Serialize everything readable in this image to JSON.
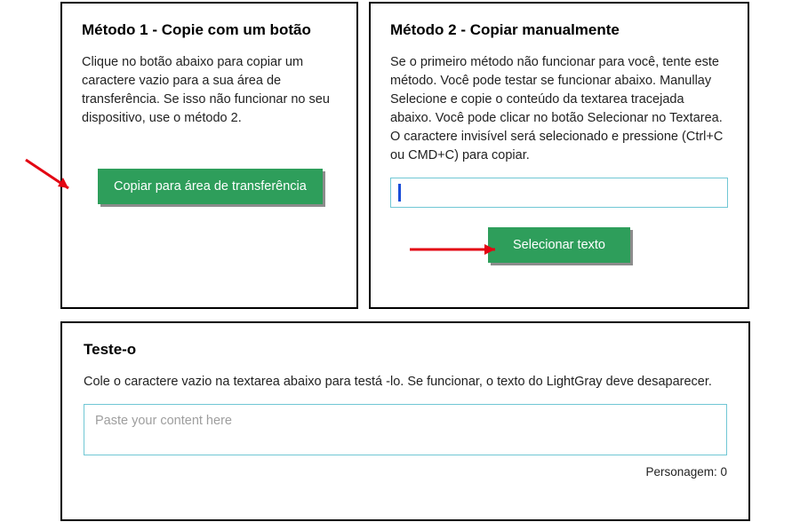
{
  "method1": {
    "title": "Método 1 - Copie com um botão",
    "description": "Clique no botão abaixo para copiar um caractere vazio para a sua área de transferência. Se isso não funcionar no seu dispositivo, use o método 2.",
    "button_label": "Copiar para área de transferência"
  },
  "method2": {
    "title": "Método 2 - Copiar manualmente",
    "description": "Se o primeiro método não funcionar para você, tente este método. Você pode testar se funcionar abaixo. Manullay Selecione e copie o conteúdo da textarea tracejada abaixo. Você pode clicar no botão Selecionar no Textarea. O caractere invisível será selecionado e pressione (Ctrl+C ou CMD+C) para copiar.",
    "button_label": "Selecionar texto"
  },
  "test": {
    "title": "Teste-o",
    "description": "Cole o caractere vazio na textarea abaixo para testá -lo. Se funcionar, o texto do LightGray deve desaparecer.",
    "placeholder": "Paste your content here",
    "char_label": "Personagem: 0"
  },
  "colors": {
    "button_bg": "#2e9e5b",
    "arrow": "#e30613",
    "input_border": "#70c7d4"
  }
}
